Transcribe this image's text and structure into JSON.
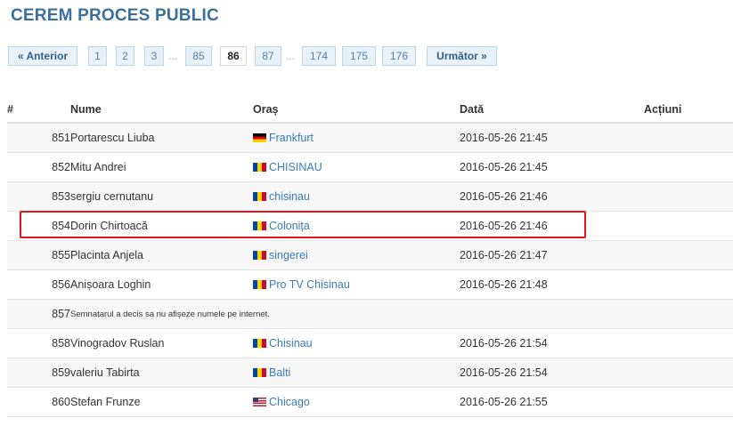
{
  "page": {
    "title": "CEREM PROCES PUBLIC"
  },
  "pagination": {
    "prev_label": "« Anterior",
    "next_label": "Următor »",
    "ellipsis": "...",
    "pages": [
      "1",
      "2",
      "3",
      "85",
      "86",
      "87",
      "174",
      "175",
      "176"
    ],
    "current": "86"
  },
  "table": {
    "headers": {
      "num": "#",
      "name": "Nume",
      "city": "Oraș",
      "date": "Dată",
      "actions": "Acțiuni"
    },
    "rows": [
      {
        "num": "851",
        "name": "Portarescu Liuba",
        "flag": "germany-flag",
        "city": "Frankfurt",
        "date": "2016-05-26 21:45"
      },
      {
        "num": "852",
        "name": "Mitu Andrei",
        "flag": "moldova-flag",
        "city": "CHISINAU",
        "date": "2016-05-26 21:45"
      },
      {
        "num": "853",
        "name": "sergiu cernutanu",
        "flag": "moldova-flag",
        "city": "chisinau",
        "date": "2016-05-26 21:46"
      },
      {
        "num": "854",
        "name": "Dorin Chirtoacă",
        "flag": "moldova-flag",
        "city": "Colonița",
        "date": "2016-05-26 21:46"
      },
      {
        "num": "855",
        "name": "Placinta Anjela",
        "flag": "moldova-flag",
        "city": "singerei",
        "date": "2016-05-26 21:47"
      },
      {
        "num": "856",
        "name": "Anișoara Loghin",
        "flag": "moldova-flag",
        "city": "Pro TV Chisinau",
        "date": "2016-05-26 21:48"
      },
      {
        "num": "857",
        "note": "Semnatarul a decis sa nu afișeze numele pe internet."
      },
      {
        "num": "858",
        "name": "Vinogradov Ruslan",
        "flag": "moldova-flag",
        "city": "Chisinau",
        "date": "2016-05-26 21:54"
      },
      {
        "num": "859",
        "name": "valeriu Tabirta",
        "flag": "moldova-flag",
        "city": "Balti",
        "date": "2016-05-26 21:54"
      },
      {
        "num": "860",
        "name": "Stefan Frunze",
        "flag": "usa-flag",
        "city": "Chicago",
        "date": "2016-05-26 21:55"
      }
    ]
  },
  "colors": {
    "title": "#3a6f9f",
    "link": "#3a7ab8",
    "highlight": "#e8131b",
    "stripe": "#f7f7f7"
  }
}
